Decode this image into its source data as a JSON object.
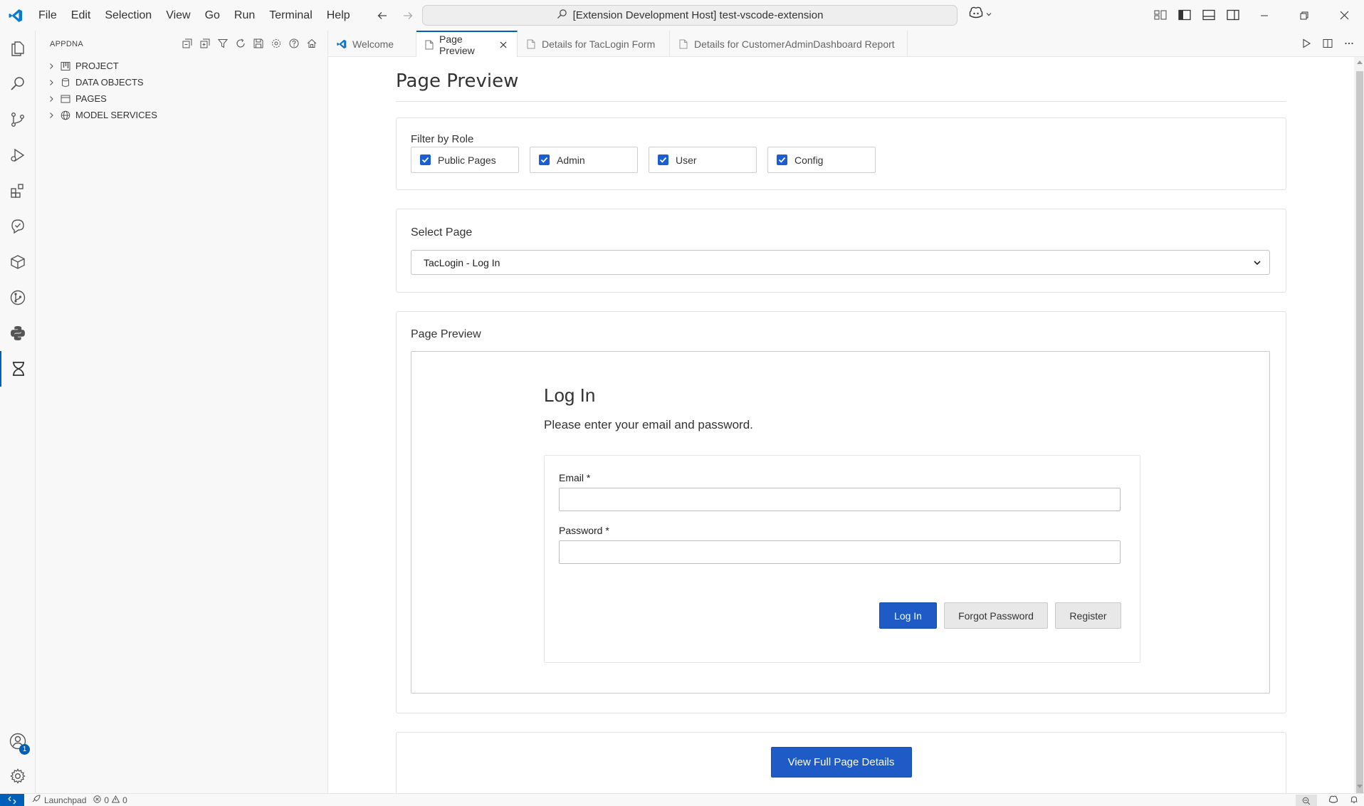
{
  "titlebar": {
    "menu": [
      "File",
      "Edit",
      "Selection",
      "View",
      "Go",
      "Run",
      "Terminal",
      "Help"
    ],
    "command_center": "[Extension Development Host] test-vscode-extension"
  },
  "sidebar": {
    "title": "APPDNA",
    "items": [
      {
        "label": "PROJECT"
      },
      {
        "label": "DATA OBJECTS"
      },
      {
        "label": "PAGES"
      },
      {
        "label": "MODEL SERVICES"
      }
    ]
  },
  "tabs": [
    {
      "label": "Welcome"
    },
    {
      "label": "Page Preview"
    },
    {
      "label": "Details for TacLogin Form"
    },
    {
      "label": "Details for CustomerAdminDashboard Report"
    }
  ],
  "editor": {
    "page_title": "Page Preview",
    "filter": {
      "label": "Filter by Role",
      "options": [
        {
          "label": "Public Pages",
          "checked": true
        },
        {
          "label": "Admin",
          "checked": true
        },
        {
          "label": "User",
          "checked": true
        },
        {
          "label": "Config",
          "checked": true
        }
      ]
    },
    "select_page": {
      "label": "Select Page",
      "value": "TacLogin - Log In"
    },
    "preview": {
      "label": "Page Preview",
      "login_title": "Log In",
      "login_subtitle": "Please enter your email and password.",
      "email_label": "Email *",
      "password_label": "Password *",
      "login_button": "Log In",
      "forgot_button": "Forgot Password",
      "register_button": "Register"
    },
    "view_details_button": "View Full Page Details"
  },
  "statusbar": {
    "launchpad": "Launchpad",
    "errors": "0",
    "warnings": "0"
  },
  "activity_badge": "1",
  "colors": {
    "accent": "#005fb8",
    "primary_button": "#1e5bc6",
    "checkbox": "#1a5fd1"
  }
}
